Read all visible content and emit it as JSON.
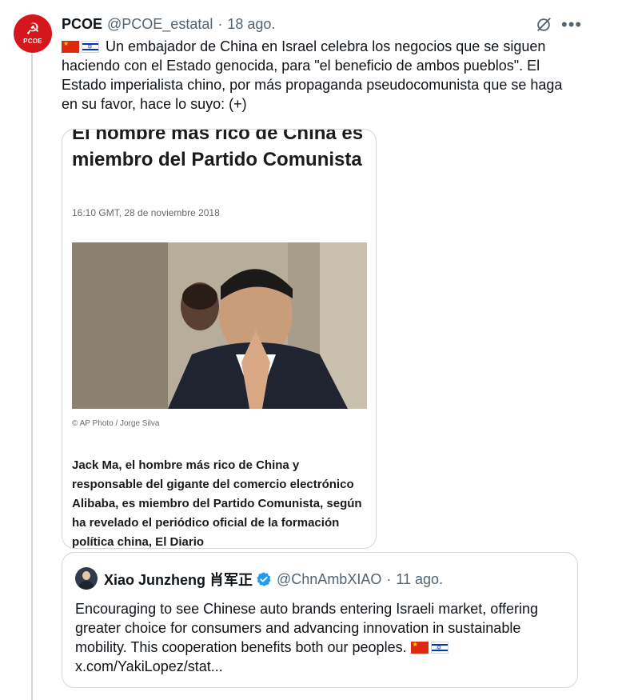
{
  "colors": {
    "brand_red": "#d5161c",
    "verified_blue": "#1d9bf0",
    "muted": "#536471",
    "border": "#cfd9de"
  },
  "tweet": {
    "avatar": {
      "text": "PCOE",
      "symbol": "☭"
    },
    "name": "PCOE",
    "handle": "@PCOE_estatal",
    "separator": "·",
    "time": "18 ago.",
    "grok_icon": "grok-icon",
    "more_label": "•••",
    "text": "Un embajador de China en Israel celebra los negocios que se siguen haciendo con el Estado genocida, para \"el beneficio de ambos pueblos\". El Estado imperialista chino, por más propaganda pseudocomunista que se haga en su favor, hace lo suyo: (+)",
    "flags": [
      "china-flag",
      "israel-flag"
    ]
  },
  "article": {
    "title": "El hombre más rico de China es miembro del Partido Comunista",
    "date": "16:10 GMT, 28 de noviembre 2018",
    "credit": "© AP Photo / Jorge Silva",
    "body": "Jack Ma, el hombre más rico de China y responsable del gigante del comercio electrónico Alibaba, es miembro del Partido Comunista, según ha revelado el periódico oficial de la formación política china, El Diario"
  },
  "quote": {
    "name": "Xiao Junzheng 肖军正",
    "handle": "@ChnAmbXIAO",
    "separator": "·",
    "time": "11 ago.",
    "text": "Encouraging to see Chinese auto brands entering Israeli market, offering greater choice for consumers and advancing innovation in sustainable mobility. This cooperation benefits both our peoples.",
    "link": "x.com/YakiLopez/stat..."
  }
}
